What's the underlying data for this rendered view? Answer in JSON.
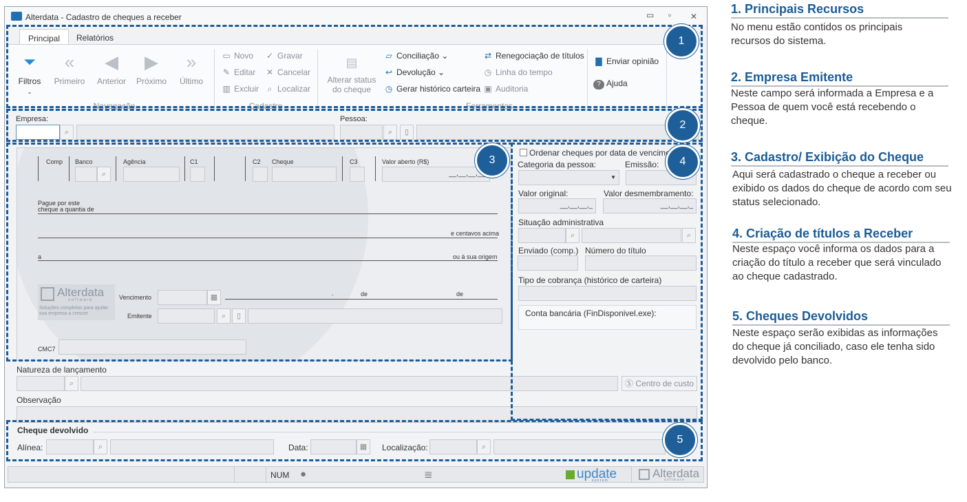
{
  "window": {
    "title": "Alterdata - Cadastro de cheques a receber",
    "min": "▭",
    "max": "▫",
    "close": "✕"
  },
  "tabs": [
    "Principal",
    "Relatórios"
  ],
  "nav": {
    "filtros": "Filtros",
    "primeiro": "Primeiro",
    "anterior": "Anterior",
    "proximo": "Próximo",
    "ultimo": "Último",
    "group": "Navegação"
  },
  "cadastro": {
    "novo": "Novo",
    "gravar": "Gravar",
    "editar": "Editar",
    "cancelar": "Cancelar",
    "excluir": "Excluir",
    "localizar": "Localizar",
    "group": "Cadastro"
  },
  "ferramentas": {
    "alterar1": "Alterar status",
    "alterar2": "do cheque",
    "conciliacao": "Conciliação",
    "devolucao": "Devolução",
    "gerar": "Gerar histórico carteira",
    "reneg": "Renegociação de títulos",
    "linha": "Linha do tempo",
    "auditoria": "Auditoria",
    "group": "Ferramentas"
  },
  "extra": {
    "enviar": "Enviar opinião",
    "ajuda": "Ajuda"
  },
  "fields": {
    "empresa": "Empresa:",
    "pessoa": "Pessoa:"
  },
  "cheque": {
    "comp": "Comp",
    "banco": "Banco",
    "agencia": "Agência",
    "c1": "C1",
    "c2": "C2",
    "cheque": "Cheque",
    "c3": "C3",
    "valor": "Valor aberto (R$)",
    "valor_mask": "__,__,__,__",
    "pague1": "Pague por este",
    "pague2": "cheque a quantia de",
    "centavos": "e centavos acima",
    "a": "a",
    "origem": "ou à sua origem",
    "logo": "Alterdata",
    "logo_sub": "s o f t w a r e",
    "logo_tag1": "Soluções completas para ajudar",
    "logo_tag2": "sua empresa a crescer",
    "vencimento": "Vencimento",
    "emitente": "Emitente",
    "de1": "de",
    "de2": "de",
    "cmc7": "CMC7",
    "dot": "."
  },
  "right": {
    "ordenar": "Ordenar cheques por data de vencimento",
    "categoria": "Categoria da pessoa:",
    "emissao": "Emissão:",
    "valor_orig": "Valor original:",
    "valor_desm": "Valor desmembramento:",
    "mask": "__,__,__,_",
    "situacao": "Situação administrativa",
    "enviado": "Enviado (comp.)",
    "numero": "Número do título",
    "tipo": "Tipo de cobrança (histórico de carteira)",
    "conta": "Conta bancária (FinDisponivel.exe):"
  },
  "lower": {
    "natureza": "Natureza de lançamento",
    "centro": "Centro de custo",
    "obs": "Observação"
  },
  "devolvido": {
    "title": "Cheque devolvido",
    "alinea": "Alínea:",
    "data": "Data:",
    "local": "Localização:"
  },
  "status": {
    "num": "NUM",
    "update": "update",
    "update_sub": "s y s t e m",
    "alter": "Alterdata",
    "alter_sub": "s o f t w a r e"
  },
  "badges": [
    "1",
    "2",
    "3",
    "4",
    "5"
  ],
  "panel": [
    {
      "h": "1. Principais Recursos",
      "t": "No menu estão contidos os principais recursos do sistema."
    },
    {
      "h": "2. Empresa Emitente",
      "t": "Neste campo será informada a Empresa e a Pessoa de quem você está recebendo o cheque."
    },
    {
      "h": "3. Cadastro/ Exibição do Cheque",
      "t": "Aqui será cadastrado o cheque a receber ou exibido os dados do cheque de acordo com seu status selecionado."
    },
    {
      "h": "4. Criação de títulos a Receber",
      "t": "Neste espaço você informa os dados para a criação do título a receber que será vinculado ao cheque cadastrado."
    },
    {
      "h": "5. Cheques Devolvidos",
      "t": "Neste espaço serão exibidas as informações do cheque já conciliado, caso ele tenha sido devolvido pelo banco."
    }
  ],
  "colors": {
    "accent": "#1f5f99",
    "dash": "#1d5c99",
    "filter": "#1e8fd6"
  }
}
